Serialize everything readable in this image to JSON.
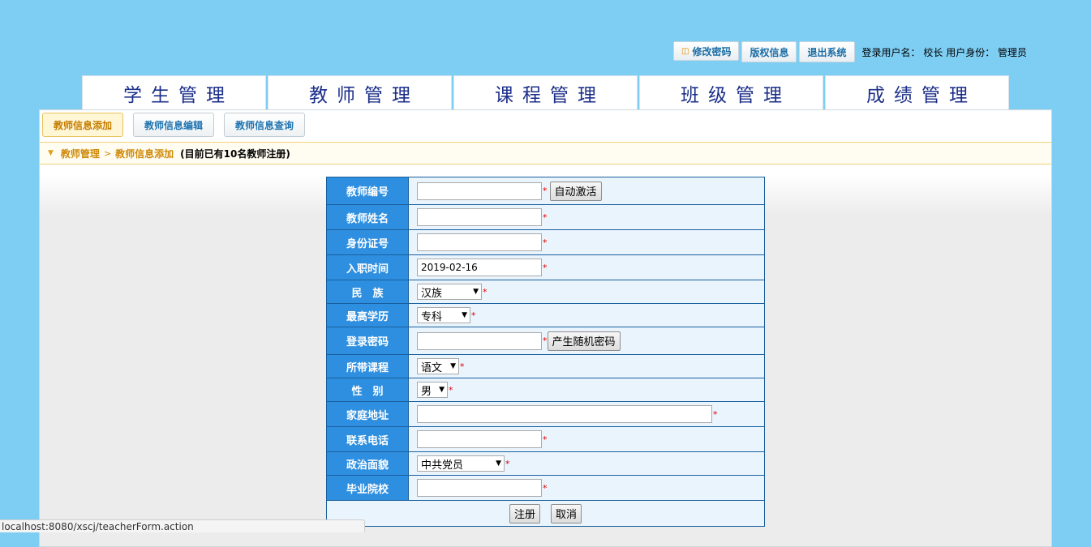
{
  "topbar": {
    "change_password": "修改密码",
    "copyright": "版权信息",
    "logout": "退出系统",
    "user_label": "登录用户名：",
    "user_name": "校长",
    "role_label": "用户身份：",
    "role_name": "管理员"
  },
  "modules": [
    "学生管理",
    "教师管理",
    "课程管理",
    "班级管理",
    "成绩管理"
  ],
  "subtabs": [
    "教师信息添加",
    "教师信息编辑",
    "教师信息查询"
  ],
  "breadcrumb": {
    "parent": "教师管理",
    "current": "教师信息添加",
    "note": "(目前已有10名教师注册)"
  },
  "form": {
    "teacher_id": {
      "label": "教师编号",
      "value": "",
      "button": "自动激活"
    },
    "teacher_name": {
      "label": "教师姓名",
      "value": ""
    },
    "id_number": {
      "label": "身份证号",
      "value": ""
    },
    "hire_date": {
      "label": "入职时间",
      "value": "2019-02-16"
    },
    "ethnicity": {
      "label": "民　族",
      "selected": "汉族"
    },
    "education": {
      "label": "最高学历",
      "selected": "专科"
    },
    "password": {
      "label": "登录密码",
      "value": "",
      "button": "产生随机密码"
    },
    "course": {
      "label": "所带课程",
      "selected": "语文"
    },
    "gender": {
      "label": "性　别",
      "selected": "男"
    },
    "address": {
      "label": "家庭地址",
      "value": ""
    },
    "phone": {
      "label": "联系电话",
      "value": ""
    },
    "political": {
      "label": "政治面貌",
      "selected": "中共党员"
    },
    "school": {
      "label": "毕业院校",
      "value": ""
    },
    "required_mark": "*",
    "submit": "注册",
    "cancel": "取消"
  },
  "status_url": "localhost:8080/xscj/teacherForm.action"
}
